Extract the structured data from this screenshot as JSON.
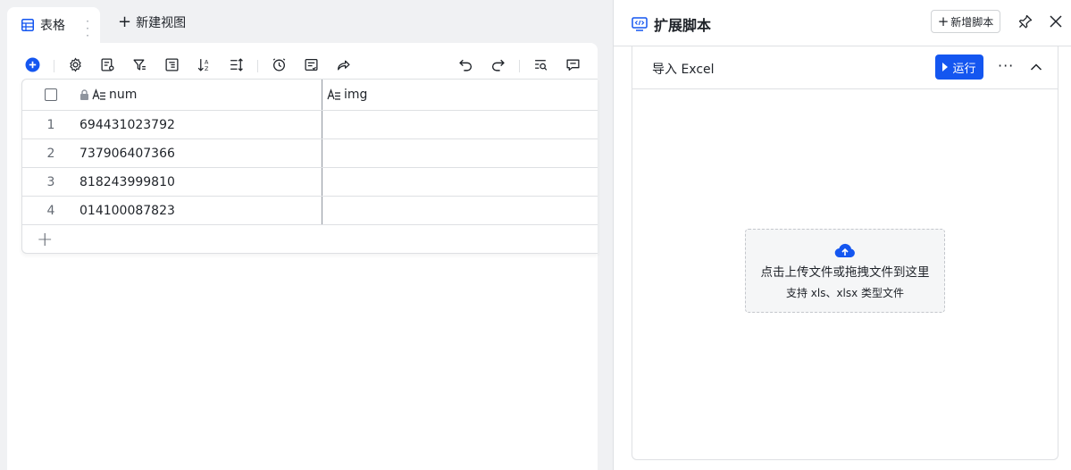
{
  "tabs": {
    "active_label": "表格",
    "new_view_label": "新建视图"
  },
  "grid": {
    "columns": [
      {
        "label": "num",
        "locked": true
      },
      {
        "label": "img",
        "locked": false
      }
    ],
    "rows": [
      {
        "index": "1",
        "num": "694431023792",
        "img": ""
      },
      {
        "index": "2",
        "num": "737906407366",
        "img": ""
      },
      {
        "index": "3",
        "num": "818243999810",
        "img": ""
      },
      {
        "index": "4",
        "num": "014100087823",
        "img": ""
      }
    ],
    "add_row_glyph": "+"
  },
  "panel": {
    "title": "扩展脚本",
    "add_script_label": "新增脚本",
    "script": {
      "title": "导入 Excel",
      "run_label": "运行",
      "more_glyph": "···"
    },
    "upload": {
      "main_text": "点击上传文件或拖拽文件到这里",
      "sub_text": "支持 xls、xlsx 类型文件"
    }
  },
  "colors": {
    "accent": "#1456f0",
    "border": "#dee0e3",
    "text": "#1f2329",
    "muted": "#646a73"
  }
}
